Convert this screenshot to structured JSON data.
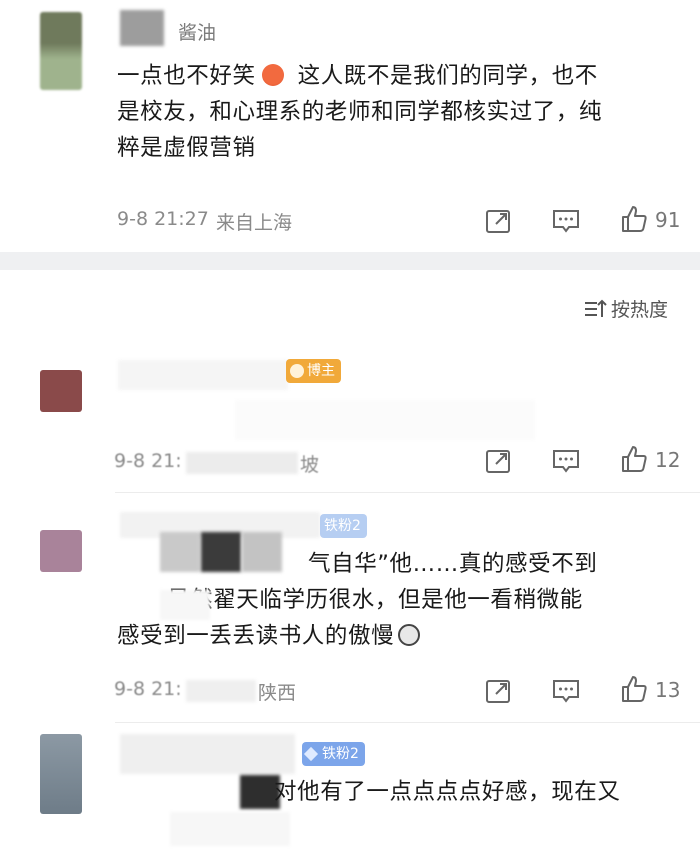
{
  "comments": [
    {
      "username_visible": "酱油",
      "text": "一点也不好笑😡 这人既不是我们的同学，也不是校友，和心理系的老师和同学都核实过了，纯粹是虚假营销",
      "lines": [
        "一点也不好笑",
        "这人既不是我们的同学，也不",
        "是校友，和心理系的老师和同学都核实过了，纯",
        "粹是虚假营销"
      ],
      "time": "9-8 21:27",
      "location": "来自上海",
      "likes": "91",
      "avatar_color": "#7f8a6b"
    },
    {
      "badge": "博主",
      "time_partial": "9-8 21:",
      "location_partial": "坡",
      "likes": "12",
      "avatar_color": "#8a4a4a"
    },
    {
      "badge": "铁粉2",
      "lines": [
        "“腹有诗书气自华”他……真的感受不到",
        "……虽然翟天临学历很水，但是他一看稍微能",
        "感受到一丢丢读书人的傲慢"
      ],
      "line1_visible": "气自华”他……真的感受不到",
      "line2_visible": "虽然翟天临学历很水，但是他一看稍微能",
      "line3_visible": "感受到一丢丢读书人的傲慢",
      "time_partial": "9-8 21:",
      "location_partial": "陕西",
      "likes": "13",
      "avatar_color": "#a9839a"
    },
    {
      "badge": "铁粉2",
      "line1_visible": "对他有了一点点点点好感，现在又",
      "avatar_color": "#7a8894"
    }
  ],
  "sort": {
    "label": "按热度"
  },
  "icons": {
    "repost": "repost-icon",
    "comment": "comment-icon",
    "like": "like-icon",
    "sort": "sort-icon"
  }
}
